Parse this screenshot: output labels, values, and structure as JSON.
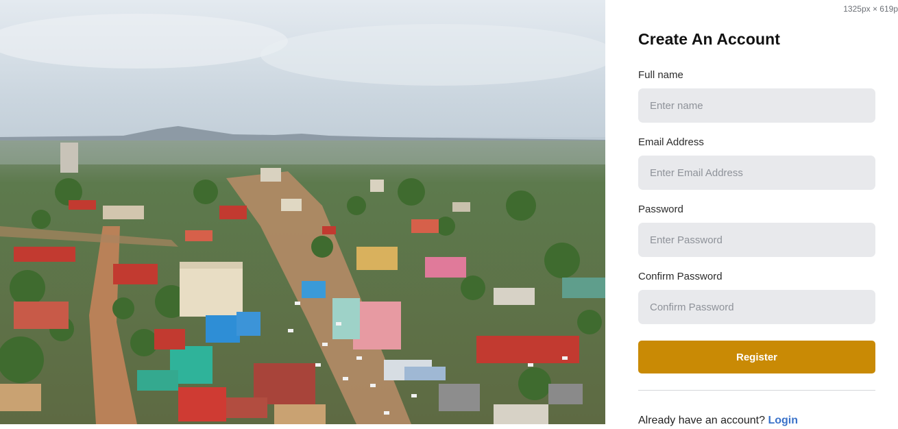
{
  "dimension_readout": "1325px × 619p",
  "hero": {
    "image": "aerial-city-photo",
    "colors": {
      "sky_top": "#e4eaf0",
      "sky_haze": "#c3cfd9",
      "mountains": "#8d9aa5",
      "vegetation": "#3f6b2f",
      "roads": "#b48158",
      "roofs": [
        "#c23a30",
        "#d9d2c0",
        "#3aa8a0",
        "#4f8fd4",
        "#e07a9a",
        "#8a8a8a"
      ]
    }
  },
  "form": {
    "title": "Create An Account",
    "fields": [
      {
        "label": "Full name",
        "placeholder": "Enter name",
        "value": ""
      },
      {
        "label": "Email Address",
        "placeholder": "Enter Email Address",
        "value": ""
      },
      {
        "label": "Password",
        "placeholder": "Enter Password",
        "value": ""
      },
      {
        "label": "Confirm Password",
        "placeholder": "Confirm Password",
        "value": ""
      }
    ],
    "submit_label": "Register",
    "footer_text": "Already have an account?",
    "login_link": "Login"
  },
  "colors": {
    "accent": "#c98a05",
    "link": "#3a72c9",
    "input_bg": "#e8e9ec"
  }
}
